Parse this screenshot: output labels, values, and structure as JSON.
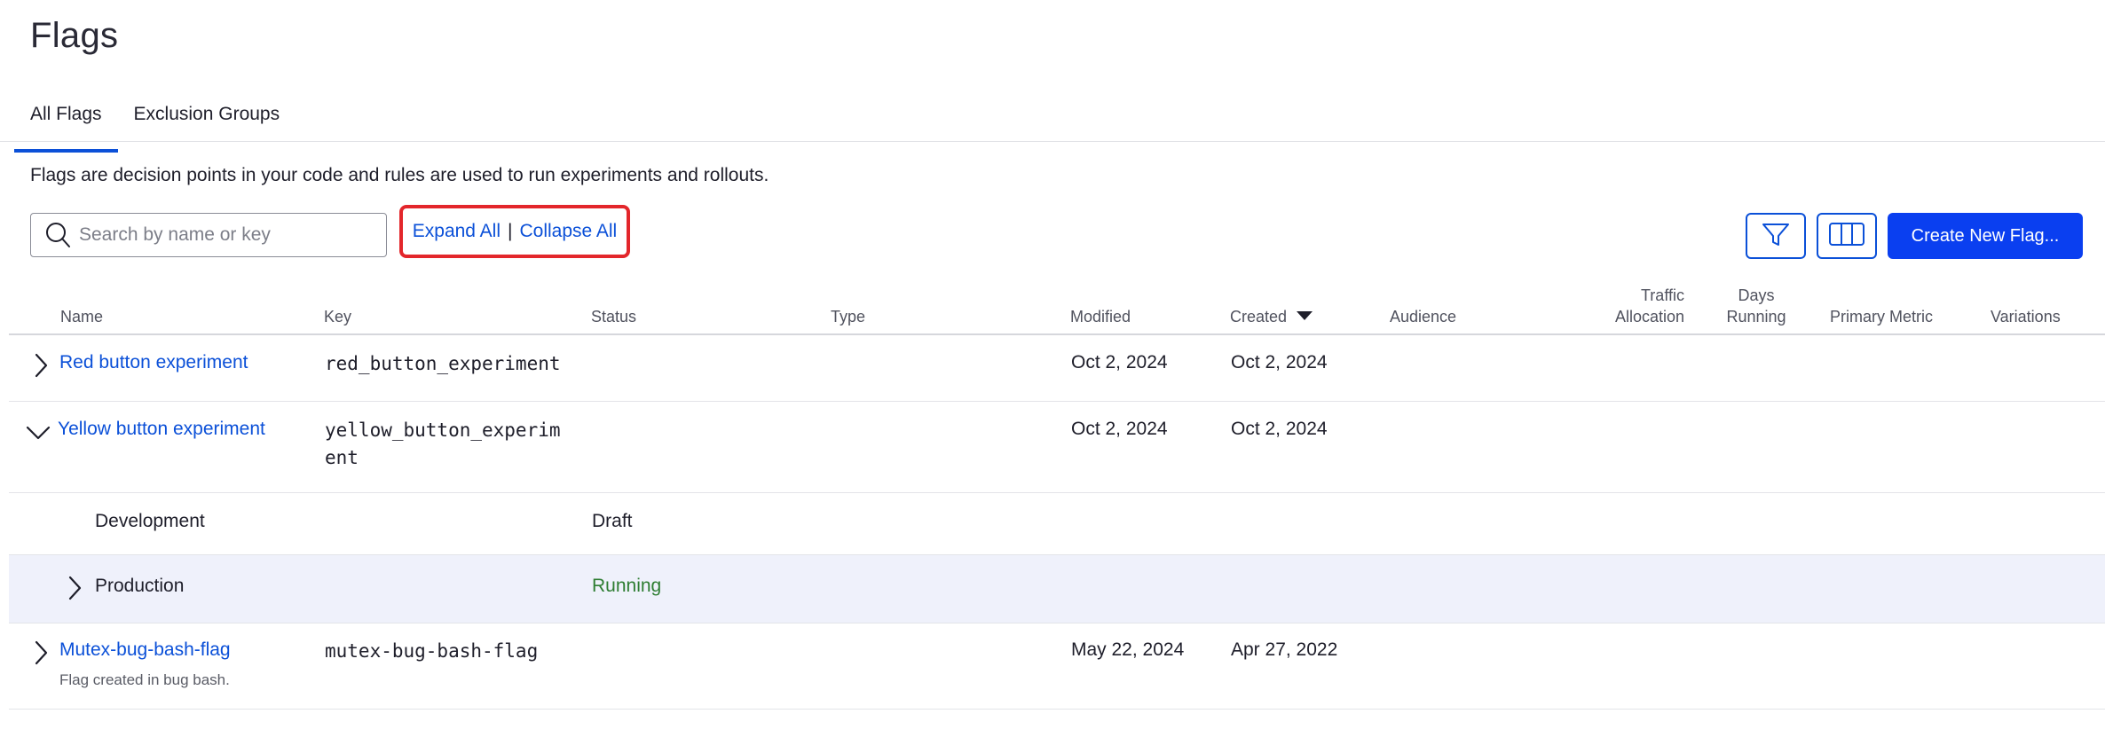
{
  "page": {
    "title": "Flags",
    "description": "Flags are decision points in your code and rules are used to run experiments and rollouts."
  },
  "tabs": [
    {
      "label": "All Flags",
      "active": true
    },
    {
      "label": "Exclusion Groups",
      "active": false
    }
  ],
  "toolbar": {
    "search_placeholder": "Search by name or key",
    "search_value": "",
    "expand_all": "Expand All",
    "separator": "|",
    "collapse_all": "Collapse All",
    "filter_icon": "filter-icon",
    "columns_icon": "columns-icon",
    "create_label": "Create New Flag..."
  },
  "table": {
    "headers": {
      "name": "Name",
      "key": "Key",
      "status": "Status",
      "type": "Type",
      "modified": "Modified",
      "created": "Created",
      "audience": "Audience",
      "traffic_allocation_1": "Traffic",
      "traffic_allocation_2": "Allocation",
      "days_running_1": "Days",
      "days_running_2": "Running",
      "primary_metric": "Primary Metric",
      "variations": "Variations"
    },
    "sort": {
      "column": "Created",
      "direction": "descending"
    },
    "rows": [
      {
        "name": "Red button experiment",
        "key": "red_button_experiment",
        "modified": "Oct 2, 2024",
        "created": "Oct 2, 2024",
        "expanded": false
      },
      {
        "name": "Yellow button experiment",
        "key_line1": "yellow_button_experim",
        "key_line2": "ent",
        "modified": "Oct 2, 2024",
        "created": "Oct 2, 2024",
        "expanded": true,
        "environments": [
          {
            "name": "Development",
            "status": "Draft"
          },
          {
            "name": "Production",
            "status": "Running"
          }
        ]
      },
      {
        "name": "Mutex-bug-bash-flag",
        "description": "Flag created in bug bash.",
        "key": "mutex-bug-bash-flag",
        "modified": "May 22, 2024",
        "created": "Apr 27, 2022",
        "expanded": false
      }
    ]
  },
  "colors": {
    "accent": "#0b50d8",
    "primary_button": "#0a3ff0",
    "highlight_border": "#e3262b",
    "running_status": "#2e7d32",
    "row_highlight": "#eff1fb"
  }
}
